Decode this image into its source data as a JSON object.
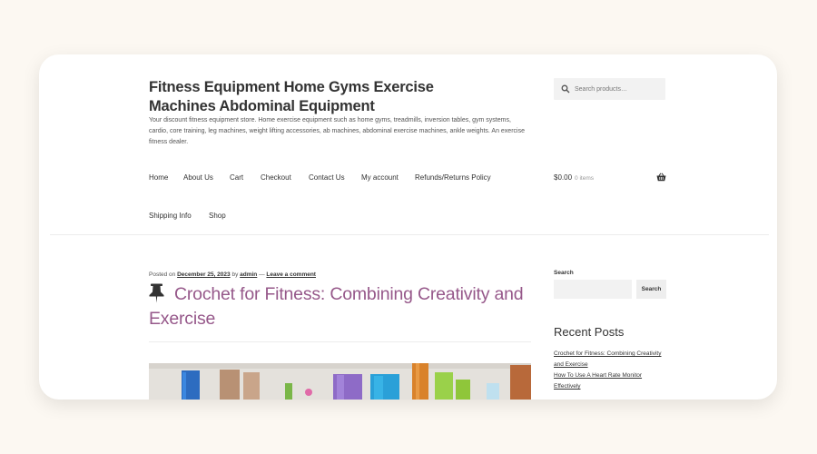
{
  "site": {
    "title": "Fitness Equipment Home Gyms Exercise Machines Abdominal Equipment",
    "description": "Your discount fitness equipment store. Home exercise equipment such as home gyms, treadmills, inversion tables, gym systems, cardio, core training, leg machines, weight lifting accessories, ab machines, abdominal exercise machines, ankle weights. An exercise fitness dealer."
  },
  "search": {
    "placeholder": "Search products…"
  },
  "nav": {
    "items": [
      "Home",
      "About Us",
      "Cart",
      "Checkout",
      "Contact Us",
      "My account",
      "Refunds/Returns Policy",
      "Shipping Info",
      "Shop"
    ]
  },
  "cart": {
    "amount": "$0.00",
    "count": "0 items"
  },
  "post": {
    "posted_on_label": "Posted on",
    "date": "December 25, 2023",
    "by_label": "by",
    "author": "admin",
    "separator": "—",
    "comment_link": "Leave a comment",
    "title": "Crochet for Fitness: Combining Creativity and Exercise"
  },
  "sidebar": {
    "search_label": "Search",
    "search_button": "Search",
    "recent_heading": "Recent Posts",
    "recent_posts": [
      "Crochet for Fitness: Combining Creativity and Exercise",
      "How To Use A Heart Rate Monitor Effectively"
    ]
  },
  "icons": {
    "search": "search-icon",
    "basket": "basket-icon",
    "pin": "thumbtack-icon"
  },
  "colors": {
    "background": "#fcf8f2",
    "post_title": "#96588a",
    "text": "#333333"
  }
}
